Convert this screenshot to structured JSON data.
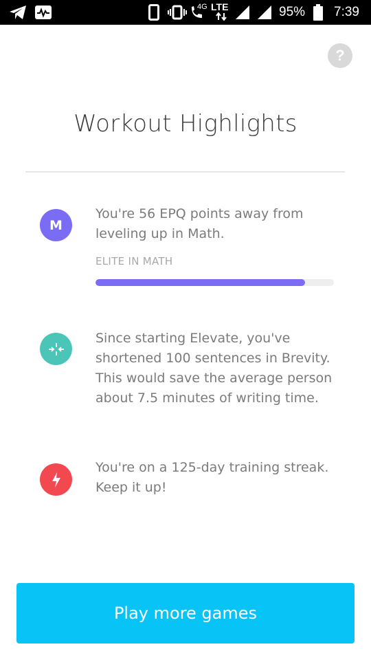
{
  "status_bar": {
    "network_type": "4G",
    "lte_label": "LTE",
    "battery_percent": "95%",
    "time": "7:39",
    "icons": [
      "telegram-icon",
      "activity-icon",
      "phone-device-icon",
      "vibrate-icon",
      "wifi-calling-icon",
      "signal-icon",
      "signal-icon",
      "battery-icon"
    ]
  },
  "help": {
    "label": "?"
  },
  "page": {
    "title": "Workout Highlights"
  },
  "highlights": [
    {
      "icon": "math-m-icon",
      "icon_letter": "M",
      "icon_color": "#7b6cf6",
      "text": "You're 56 EPQ points away from leveling up in Math.",
      "level_label": "ELITE IN MATH",
      "progress": 0.88,
      "progress_color": "#7b6cf6"
    },
    {
      "icon": "brevity-compress-icon",
      "icon_color": "#4cc5b9",
      "text": "Since starting Elevate, you've shortened 100 sentences in Brevity. This would save the average person about 7.5 minutes of writing time."
    },
    {
      "icon": "lightning-bolt-icon",
      "icon_color": "#f2484f",
      "text": "You're on a 125-day training streak. Keep it up!"
    }
  ],
  "cta": {
    "label": "Play more games",
    "color": "#08c3f6"
  }
}
